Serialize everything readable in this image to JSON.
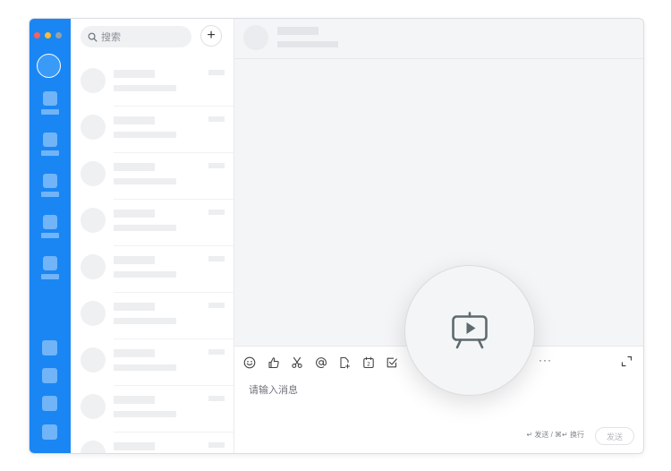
{
  "window": {
    "traffic_lights": {
      "close": "#ff5f57",
      "minimize": "#febc2e",
      "zoom": "#9aa0a6"
    }
  },
  "rail": {
    "background": "#1a86f3",
    "items": [
      "nav-item-1",
      "nav-item-2",
      "nav-item-3",
      "nav-item-4",
      "nav-item-5"
    ],
    "bottom_items": [
      "bottom-item-1",
      "bottom-item-2",
      "bottom-item-3",
      "bottom-item-4"
    ]
  },
  "conversation_list": {
    "search": {
      "placeholder": "搜索",
      "icon": "search-icon"
    },
    "add_button": {
      "label": "+",
      "icon": "plus-icon"
    },
    "items_visible": 9
  },
  "chat": {
    "composer": {
      "toolbar": [
        "emoji-icon",
        "thumbs-up-icon",
        "scissors-icon",
        "at-mention-icon",
        "file-upload-icon",
        "calendar-icon",
        "checkbox-icon"
      ],
      "more_label": "···",
      "expand_icon": "expand-icon",
      "placeholder": "请输入消息",
      "shortcut_hint": "↵ 发送 / ⌘↵ 换行",
      "send_label": "发送"
    }
  },
  "spotlight": {
    "icon": "presentation-play-icon"
  }
}
